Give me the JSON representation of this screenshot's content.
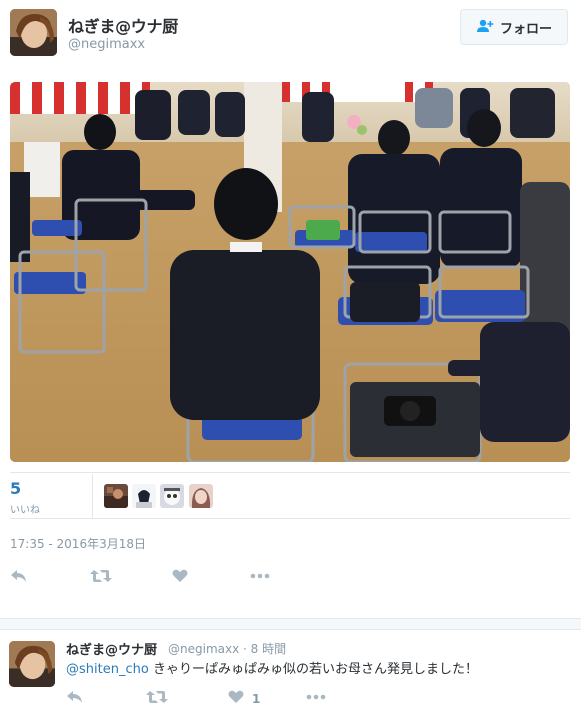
{
  "tweet": {
    "display_name": "ねぎま@ウナ厨",
    "handle": "@negimaxx",
    "follow_label": "フォロー",
    "likes_count": "5",
    "likes_label": "いいね",
    "timestamp": "17:35 - 2016年3月18日"
  },
  "reply": {
    "display_name": "ねぎま@ウナ厨",
    "meta": "@negimaxx · 8 時間",
    "mention": "@shiten_cho",
    "text": " きゃりーぱみゅぱみゅ似の若いお母さん発見しました！",
    "like_count": "1"
  },
  "icons": [
    "reply-icon",
    "retweet-icon",
    "heart-icon",
    "more-icon",
    "follow-icon"
  ],
  "colors": {
    "link": "#2b7bb9",
    "muted": "#8899a6",
    "text": "#292f33"
  }
}
